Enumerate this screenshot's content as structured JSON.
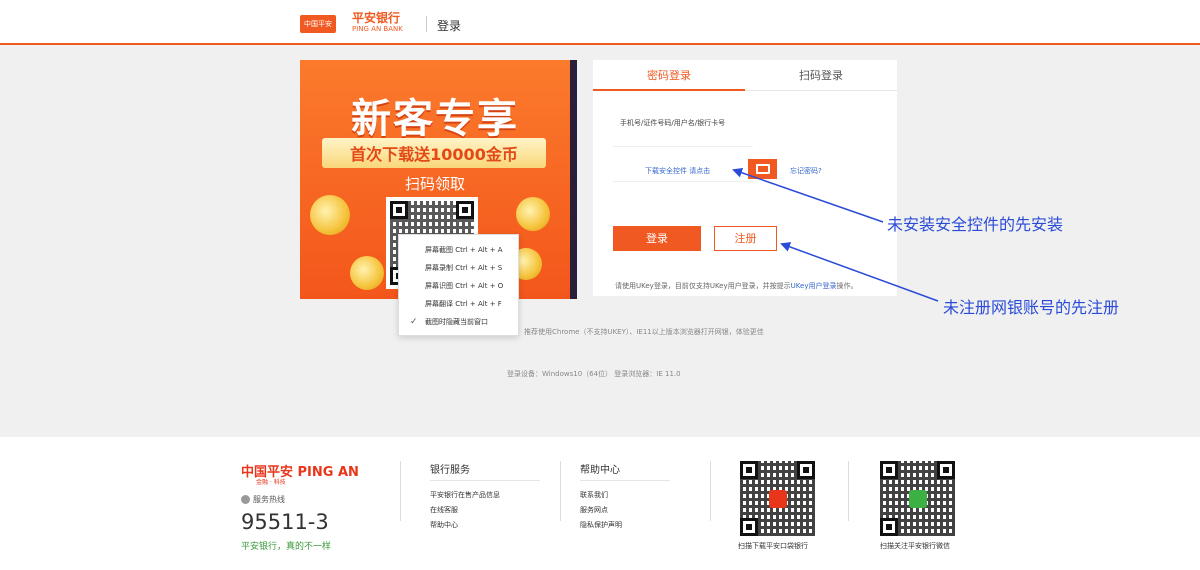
{
  "header": {
    "logo_badge": "中国平安",
    "logo_cn": "平安银行",
    "logo_en": "PING AN BANK",
    "title": "登录"
  },
  "banner": {
    "title": "新客专享",
    "ribbon": "首次下载送10000金币",
    "scan_text": "扫码领取"
  },
  "context_menu": {
    "items": [
      {
        "label": "屏幕截图 Ctrl + Alt + A",
        "checked": false
      },
      {
        "label": "屏幕录制 Ctrl + Alt + S",
        "checked": false
      },
      {
        "label": "屏幕识图 Ctrl + Alt + O",
        "checked": false
      },
      {
        "label": "屏幕翻译 Ctrl + Alt + F",
        "checked": false
      },
      {
        "label": "截图时隐藏当前窗口",
        "checked": true
      }
    ]
  },
  "login": {
    "tabs": [
      {
        "label": "密码登录",
        "active": true
      },
      {
        "label": "扫码登录",
        "active": false
      }
    ],
    "account_placeholder": "手机号/证件号码/用户名/银行卡号",
    "install_link": "下载安全控件 请点击",
    "forgot_link": "忘记密码?",
    "login_button": "登录",
    "register_button": "注册",
    "hint_prefix": "请使用UKey登录，目前仅支持UKey用户登录，并按提示",
    "hint_link": "UKey用户登录",
    "hint_suffix": "操作。"
  },
  "notes": {
    "browser": "推荐使用Chrome（不支持UKEY）、IE11以上版本浏览器打开网银，体验更佳",
    "environment": "登录设备：Windows10（64位）    登录浏览器：IE 11.0"
  },
  "annotations": {
    "install_note": "未安装安全控件的先安装",
    "register_note": "未注册网银账号的先注册",
    "color": "#2a4bd7"
  },
  "footer": {
    "logo": "中国平安 PING AN",
    "logo_sub": "金融 · 科技",
    "hotline_label": "服务热线",
    "hotline": "95511-3",
    "slogan": "平安银行，真的不一样",
    "col1": {
      "title": "银行服务",
      "items": [
        "平安银行在售产品信息",
        "在线客服",
        "帮助中心"
      ]
    },
    "col2": {
      "title": "帮助中心",
      "items": [
        "联系我们",
        "服务网点",
        "隐私保护声明"
      ]
    },
    "qr1_caption": "扫描下载平安口袋银行",
    "qr2_caption": "扫描关注平安银行微信"
  },
  "colors": {
    "brand": "#f05a22",
    "link": "#3366cc",
    "slogan": "#3a9a3a"
  }
}
